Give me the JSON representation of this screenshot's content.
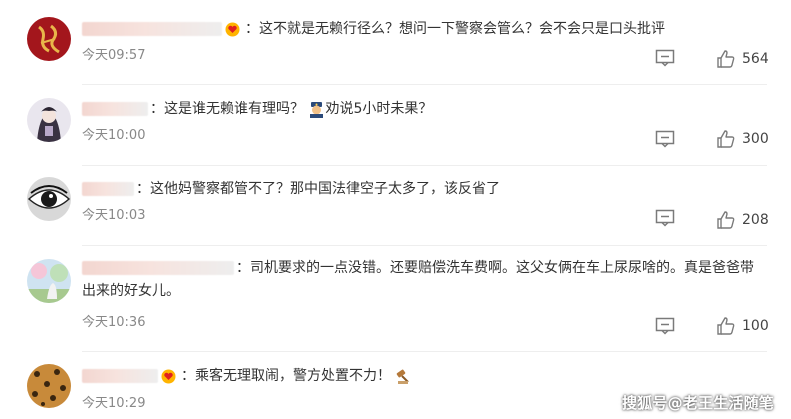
{
  "comments": [
    {
      "text": "这不就是无赖行径么？想问一下警察会管么？会不会只是口头批评",
      "time": "今天09:57",
      "likes": "564",
      "avatar": "red-calligraphy-avatar"
    },
    {
      "text": "这是谁无赖谁有理吗？",
      "text2": "劝说5小时未果？",
      "time": "今天10:00",
      "likes": "300",
      "avatar": "anime-girl-avatar"
    },
    {
      "text": "这他妈警察都管不了？那中国法律空子太多了，该反省了",
      "time": "今天10:03",
      "likes": "208",
      "avatar": "eye-closeup-avatar"
    },
    {
      "text": "司机要求的一点没错。还要赔偿洗车费啊。这父女俩在车上尿尿啥的。真是爸爸带出来的好女儿。",
      "time": "今天10:36",
      "likes": "100",
      "avatar": "pastel-landscape-avatar"
    },
    {
      "text": "乘客无理取闹，警方处置不力！",
      "time": "今天10:29",
      "likes": "",
      "avatar": "leopard-avatar"
    }
  ],
  "colon": "：",
  "watermark": "搜狐号@老王生活随笔",
  "colors": {
    "text": "#333333",
    "time": "#888888",
    "icon": "#7a7a7a",
    "separator": "#eeeeee"
  }
}
